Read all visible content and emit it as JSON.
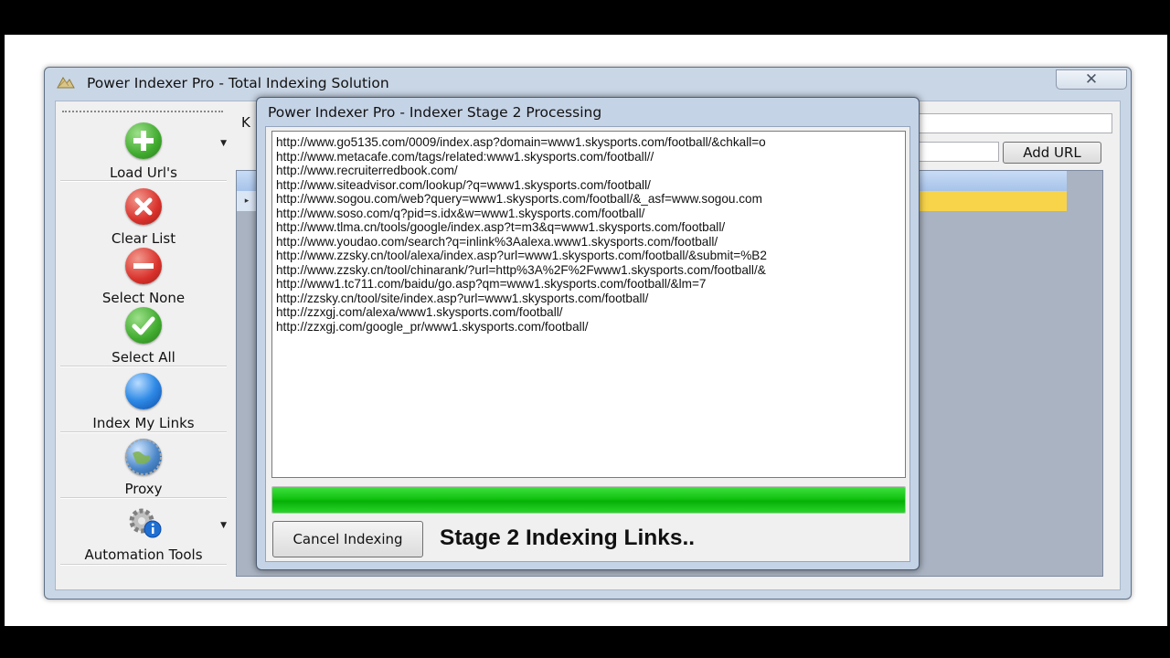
{
  "main_window": {
    "title": "Power Indexer Pro - Total Indexing Solution",
    "close_glyph": "✕"
  },
  "sidebar": {
    "items": [
      {
        "label": "Load Url's",
        "icon": "add-icon",
        "color": "#3faa2e"
      },
      {
        "label": "Clear List",
        "icon": "close-icon",
        "color": "#d9312b"
      },
      {
        "label": "Select None",
        "icon": "minus-icon",
        "color": "#d9312b"
      },
      {
        "label": "Select All",
        "icon": "check-icon",
        "color": "#3faa2e"
      },
      {
        "label": "Index My Links",
        "icon": "blue-orb-icon",
        "color": "#1f6fd1"
      },
      {
        "label": "Proxy",
        "icon": "globe-icon",
        "color": "#4a86c8"
      },
      {
        "label": "Automation Tools",
        "icon": "gear-info-icon",
        "color": "#1f6fd1"
      }
    ]
  },
  "main_panel": {
    "keyword_label": "K",
    "add_url_label": "Add URL",
    "row_marker": "▸"
  },
  "dialog": {
    "title": "Power Indexer Pro - Indexer Stage 2 Processing",
    "log_lines": [
      "http://www.go5135.com/0009/index.asp?domain=www1.skysports.com/football/&chkall=o",
      "http://www.metacafe.com/tags/related:www1.skysports.com/football//",
      "http://www.recruiterredbook.com/",
      "http://www.siteadvisor.com/lookup/?q=www1.skysports.com/football/",
      "http://www.sogou.com/web?query=www1.skysports.com/football/&_asf=www.sogou.com",
      "http://www.soso.com/q?pid=s.idx&w=www1.skysports.com/football/",
      "http://www.tlma.cn/tools/google/index.asp?t=m3&q=www1.skysports.com/football/",
      "http://www.youdao.com/search?q=inlink%3Aalexa.www1.skysports.com/football/",
      "http://www.zzsky.cn/tool/alexa/index.asp?url=www1.skysports.com/football/&submit=%B2",
      "http://www.zzsky.cn/tool/chinarank/?url=http%3A%2F%2Fwww1.skysports.com/football/&",
      "http://www1.tc711.com/baidu/go.asp?qm=www1.skysports.com/football/&lm=7",
      "http://zzsky.cn/tool/site/index.asp?url=www1.skysports.com/football/",
      "http://zzxgj.com/alexa/www1.skysports.com/football/",
      "http://zzxgj.com/google_pr/www1.skysports.com/football/"
    ],
    "progress_fraction": 1.0,
    "progress_color": "#12c312",
    "cancel_label": "Cancel Indexing",
    "status_text": "Stage 2 Indexing Links.."
  }
}
